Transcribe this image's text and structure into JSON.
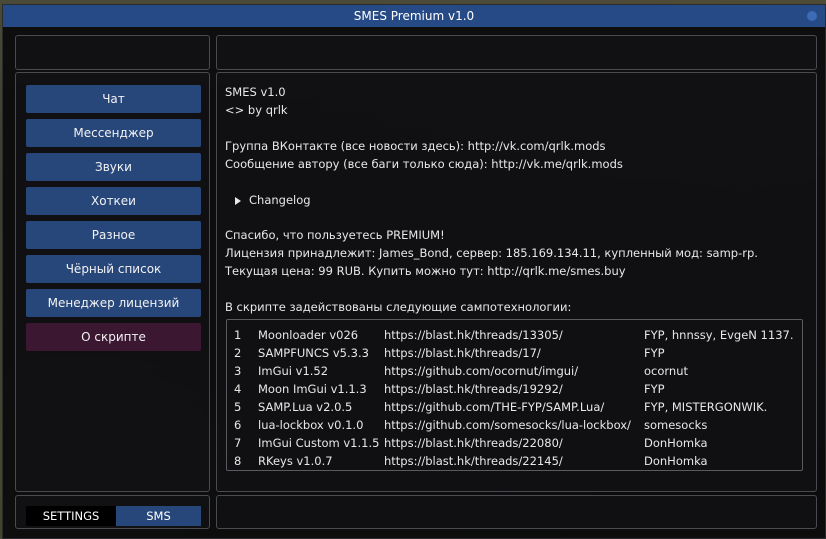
{
  "window": {
    "title": "SMES Premium v1.0"
  },
  "sidebar": {
    "items": [
      {
        "label": "Чат"
      },
      {
        "label": "Мессенджер"
      },
      {
        "label": "Звуки"
      },
      {
        "label": "Хоткеи"
      },
      {
        "label": "Разное"
      },
      {
        "label": "Чёрный список"
      },
      {
        "label": "Менеджер лицензий"
      },
      {
        "label": "О скрипте",
        "active": true
      }
    ]
  },
  "about": {
    "name": "SMES v1.0",
    "author": "<> by qrlk",
    "vk_group": "Группа ВКонтакте (все новости здесь): http://vk.com/qrlk.mods",
    "vk_author": "Сообщение автору (все баги только сюда): http://vk.me/qrlk.mods",
    "changelog": "Changelog",
    "thanks": "Спасибо, что пользуетесь PREMIUM!",
    "license": "Лицензия принадлежит: James_Bond, сервер: 185.169.134.11, купленный мод: samp-rp.",
    "price": "Текущая цена: 99 RUB. Купить можно тут: http://qrlk.me/smes.buy",
    "tech_intro": "В скрипте задействованы следующие сампотехнологии:",
    "technologies": [
      {
        "n": "1",
        "name": "Moonloader v026",
        "url": "https://blast.hk/threads/13305/",
        "authors": "FYP,  hnnssy,  EvgeN 1137."
      },
      {
        "n": "2",
        "name": "SAMPFUNCS v5.3.3",
        "url": "https://blast.hk/threads/17/",
        "authors": "FYP"
      },
      {
        "n": "3",
        "name": "ImGui v1.52",
        "url": "https://github.com/ocornut/imgui/",
        "authors": "ocornut"
      },
      {
        "n": "4",
        "name": "Moon ImGui v1.1.3",
        "url": "https://blast.hk/threads/19292/",
        "authors": "FYP"
      },
      {
        "n": "5",
        "name": "SAMP.Lua v2.0.5",
        "url": "https://github.com/THE-FYP/SAMP.Lua/",
        "authors": "FYP,  MISTERGONWIK."
      },
      {
        "n": "6",
        "name": "lua-lockbox v0.1.0",
        "url": "https://github.com/somesocks/lua-lockbox/",
        "authors": "somesocks"
      },
      {
        "n": "7",
        "name": "ImGui Custom v1.1.5",
        "url": "https://blast.hk/threads/22080/",
        "authors": "DonHomka"
      },
      {
        "n": "8",
        "name": "RKeys v1.0.7",
        "url": "https://blast.hk/threads/22145/",
        "authors": "DonHomka"
      }
    ]
  },
  "footer": {
    "settings_label": "SETTINGS",
    "sms_label": "SMS"
  },
  "colors": {
    "title_bar": "#254a86",
    "button": "#27477a",
    "active_item": "#3b1732"
  }
}
